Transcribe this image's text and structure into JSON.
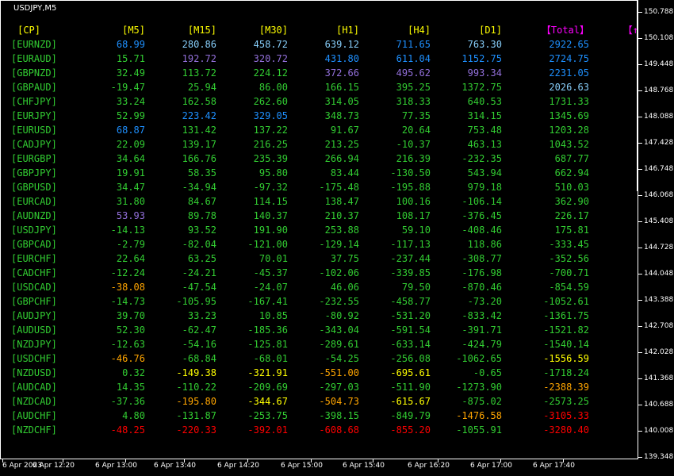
{
  "window": {
    "symbol_timeframe": "USDJPY,M5"
  },
  "price_axis": [
    "150.788",
    "150.108",
    "149.448",
    "148.768",
    "148.088",
    "147.428",
    "146.748",
    "146.068",
    "145.408",
    "144.728",
    "144.048",
    "143.388",
    "142.708",
    "142.028",
    "141.368",
    "140.688",
    "140.008",
    "139.348"
  ],
  "time_axis": [
    "6 Apr 2023",
    "6 Apr 12:20",
    "6 Apr 13:00",
    "6 Apr 13:40",
    "6 Apr 14:20",
    "6 Apr 15:00",
    "6 Apr 15:40",
    "6 Apr 16:20",
    "6 Apr 17:00",
    "6 Apr 17:40"
  ],
  "table": {
    "headers": [
      "[CP]",
      "[M5]",
      "[M15]",
      "[M30]",
      "[H1]",
      "[H4]",
      "[D1]",
      "【Total】",
      "【↑"
    ],
    "header_colors": [
      "#ffff00",
      "#ffff00",
      "#ffff00",
      "#ffff00",
      "#ffff00",
      "#ffff00",
      "#ffff00",
      "#ff00ff",
      "#ff00ff"
    ],
    "pair_color": "#32cd32",
    "color_key": {
      "g": "#32cd32",
      "c": "#1e90ff",
      "s": "#87cefa",
      "v": "#9370db",
      "y": "#ffff00",
      "o": "#ffa500",
      "r": "#ff0000"
    },
    "rows": [
      {
        "pair": "[EURNZD]",
        "values": [
          "68.99",
          "280.86",
          "458.72",
          "639.12",
          "711.65",
          "763.30",
          "2922.65"
        ],
        "colors": "cssscsc"
      },
      {
        "pair": "[EURAUD]",
        "values": [
          "15.71",
          "192.72",
          "320.72",
          "431.80",
          "611.04",
          "1152.75",
          "2724.75"
        ],
        "colors": "gvvcccc"
      },
      {
        "pair": "[GBPNZD]",
        "values": [
          "32.49",
          "113.72",
          "224.12",
          "372.66",
          "495.62",
          "993.34",
          "2231.05"
        ],
        "colors": "gggvvvc"
      },
      {
        "pair": "[GBPAUD]",
        "values": [
          "-19.47",
          "25.94",
          "86.00",
          "166.15",
          "395.25",
          "1372.75",
          "2026.63"
        ],
        "colors": "ggggggsg"
      },
      {
        "pair": "[CHFJPY]",
        "values": [
          "33.24",
          "162.58",
          "262.60",
          "314.05",
          "318.33",
          "640.53",
          "1731.33"
        ],
        "colors": "ggggggg"
      },
      {
        "pair": "[EURJPY]",
        "values": [
          "52.99",
          "223.42",
          "329.05",
          "348.73",
          "77.35",
          "314.15",
          "1345.69"
        ],
        "colors": "gccgggg"
      },
      {
        "pair": "[EURUSD]",
        "values": [
          "68.87",
          "131.42",
          "137.22",
          "91.67",
          "20.64",
          "753.48",
          "1203.28"
        ],
        "colors": "cgggggg"
      },
      {
        "pair": "[CADJPY]",
        "values": [
          "22.09",
          "139.17",
          "216.25",
          "213.25",
          "-10.37",
          "463.13",
          "1043.52"
        ],
        "colors": "ggggggg"
      },
      {
        "pair": "[EURGBP]",
        "values": [
          "34.64",
          "166.76",
          "235.39",
          "266.94",
          "216.39",
          "-232.35",
          "687.77"
        ],
        "colors": "ggggggg"
      },
      {
        "pair": "[GBPJPY]",
        "values": [
          "19.91",
          "58.35",
          "95.80",
          "83.44",
          "-130.50",
          "543.94",
          "662.94"
        ],
        "colors": "ggggggg"
      },
      {
        "pair": "[GBPUSD]",
        "values": [
          "34.47",
          "-34.94",
          "-97.32",
          "-175.48",
          "-195.88",
          "979.18",
          "510.03"
        ],
        "colors": "ggggggg"
      },
      {
        "pair": "[EURCAD]",
        "values": [
          "31.80",
          "84.67",
          "114.15",
          "138.47",
          "100.16",
          "-106.14",
          "362.90"
        ],
        "colors": "ggggggg"
      },
      {
        "pair": "[AUDNZD]",
        "values": [
          "53.93",
          "89.78",
          "140.37",
          "210.37",
          "108.17",
          "-376.45",
          "226.17"
        ],
        "colors": "vgggggg"
      },
      {
        "pair": "[USDJPY]",
        "values": [
          "-14.13",
          "93.52",
          "191.90",
          "253.88",
          "59.10",
          "-408.46",
          "175.81"
        ],
        "colors": "ggggggg"
      },
      {
        "pair": "[GBPCAD]",
        "values": [
          "-2.79",
          "-82.04",
          "-121.00",
          "-129.14",
          "-117.13",
          "118.86",
          "-333.45"
        ],
        "colors": "ggggggg"
      },
      {
        "pair": "[EURCHF]",
        "values": [
          "22.64",
          "63.25",
          "70.01",
          "37.75",
          "-237.44",
          "-308.77",
          "-352.56"
        ],
        "colors": "ggggggg"
      },
      {
        "pair": "[CADCHF]",
        "values": [
          "-12.24",
          "-24.21",
          "-45.37",
          "-102.06",
          "-339.85",
          "-176.98",
          "-700.71"
        ],
        "colors": "ggggggg"
      },
      {
        "pair": "[USDCAD]",
        "values": [
          "-38.08",
          "-47.54",
          "-24.07",
          "46.06",
          "79.50",
          "-870.46",
          "-854.59"
        ],
        "colors": "ogggggg"
      },
      {
        "pair": "[GBPCHF]",
        "values": [
          "-14.73",
          "-105.95",
          "-167.41",
          "-232.55",
          "-458.77",
          "-73.20",
          "-1052.61"
        ],
        "colors": "ggggggg"
      },
      {
        "pair": "[AUDJPY]",
        "values": [
          "39.70",
          "33.23",
          "10.85",
          "-80.92",
          "-531.20",
          "-833.42",
          "-1361.75"
        ],
        "colors": "ggggggg"
      },
      {
        "pair": "[AUDUSD]",
        "values": [
          "52.30",
          "-62.47",
          "-185.36",
          "-343.04",
          "-591.54",
          "-391.71",
          "-1521.82"
        ],
        "colors": "ggggggg"
      },
      {
        "pair": "[NZDJPY]",
        "values": [
          "-12.63",
          "-54.16",
          "-125.81",
          "-289.61",
          "-633.14",
          "-424.79",
          "-1540.14"
        ],
        "colors": "ggggggg"
      },
      {
        "pair": "[USDCHF]",
        "values": [
          "-46.76",
          "-68.84",
          "-68.01",
          "-54.25",
          "-256.08",
          "-1062.65",
          "-1556.59"
        ],
        "colors": "ogggggyg"
      },
      {
        "pair": "[NZDUSD]",
        "values": [
          "0.32",
          "-149.38",
          "-321.91",
          "-551.00",
          "-695.61",
          "-0.65",
          "-1718.24"
        ],
        "colors": "gyyoygg"
      },
      {
        "pair": "[AUDCAD]",
        "values": [
          "14.35",
          "-110.22",
          "-209.69",
          "-297.03",
          "-511.90",
          "-1273.90",
          "-2388.39"
        ],
        "colors": "ggggggog"
      },
      {
        "pair": "[NZDCAD]",
        "values": [
          "-37.36",
          "-195.80",
          "-344.67",
          "-504.73",
          "-615.67",
          "-875.02",
          "-2573.25"
        ],
        "colors": "goyoyggy"
      },
      {
        "pair": "[AUDCHF]",
        "values": [
          "4.80",
          "-131.87",
          "-253.75",
          "-398.15",
          "-849.79",
          "-1476.58",
          "-3105.33"
        ],
        "colors": "gggggorо"
      },
      {
        "pair": "[NZDCHF]",
        "values": [
          "-48.25",
          "-220.33",
          "-392.01",
          "-608.68",
          "-855.20",
          "-1055.91",
          "-3280.40"
        ],
        "colors": "rrrrrgr"
      }
    ]
  }
}
